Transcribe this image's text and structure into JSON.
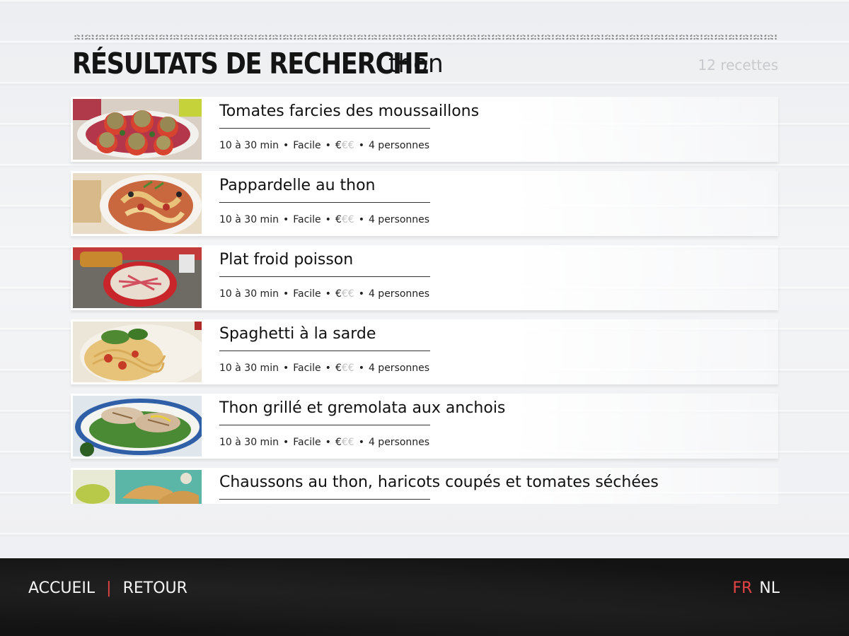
{
  "header": {
    "title": "Résultats de recherche",
    "query": "thon",
    "count": "12 recettes"
  },
  "results": [
    {
      "title": "Tomates farcies des moussaillons",
      "duration": "10 à 30 min",
      "difficulty": "Facile",
      "price_active": "€",
      "price_inactive": "€€",
      "servings": "4 personnes",
      "image": "stuffed-tomatoes-image"
    },
    {
      "title": "Pappardelle au thon",
      "duration": "10 à 30 min",
      "difficulty": "Facile",
      "price_active": "€",
      "price_inactive": "€€",
      "servings": "4 personnes",
      "image": "pappardelle-image"
    },
    {
      "title": "Plat froid poisson",
      "duration": "10 à 30 min",
      "difficulty": "Facile",
      "price_active": "€",
      "price_inactive": "€€",
      "servings": "4 personnes",
      "image": "cold-fish-salad-image"
    },
    {
      "title": "Spaghetti à la sarde",
      "duration": "10 à 30 min",
      "difficulty": "Facile",
      "price_active": "€",
      "price_inactive": "€€",
      "servings": "4 personnes",
      "image": "spaghetti-image"
    },
    {
      "title": "Thon grillé et gremolata aux anchois",
      "duration": "10 à 30 min",
      "difficulty": "Facile",
      "price_active": "€",
      "price_inactive": "€€",
      "servings": "4 personnes",
      "image": "grilled-tuna-image"
    },
    {
      "title": "Chaussons au thon, haricots coupés et tomates séchées",
      "image": "turnovers-image"
    }
  ],
  "footer": {
    "home": "ACCUEIL",
    "separator": "|",
    "back": "RETOUR",
    "lang_fr": "FR",
    "lang_nl": "NL"
  },
  "colors": {
    "accent": "#e64444",
    "footer_bg": "#131313",
    "count_text": "#c9cacd"
  }
}
